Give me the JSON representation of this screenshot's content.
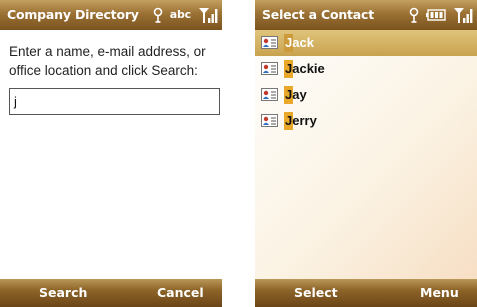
{
  "left_screen": {
    "title": "Company Directory",
    "status": {
      "abc": "abc"
    },
    "prompt": "Enter a name, e-mail address, or office location and click Search:",
    "search_input": {
      "value": "j"
    },
    "softkeys": {
      "left": "Search",
      "right": "Cancel"
    }
  },
  "right_screen": {
    "title": "Select a Contact",
    "contacts": [
      {
        "name": "Jack",
        "selected": true
      },
      {
        "name": "Jackie",
        "selected": false
      },
      {
        "name": "Jay",
        "selected": false
      },
      {
        "name": "Jerry",
        "selected": false
      }
    ],
    "softkeys": {
      "left": "Select",
      "right": "Menu"
    }
  },
  "colors": {
    "bar_gold": "#9b7134",
    "selection": "#c8a24e",
    "highlight": "#e9a82a"
  }
}
